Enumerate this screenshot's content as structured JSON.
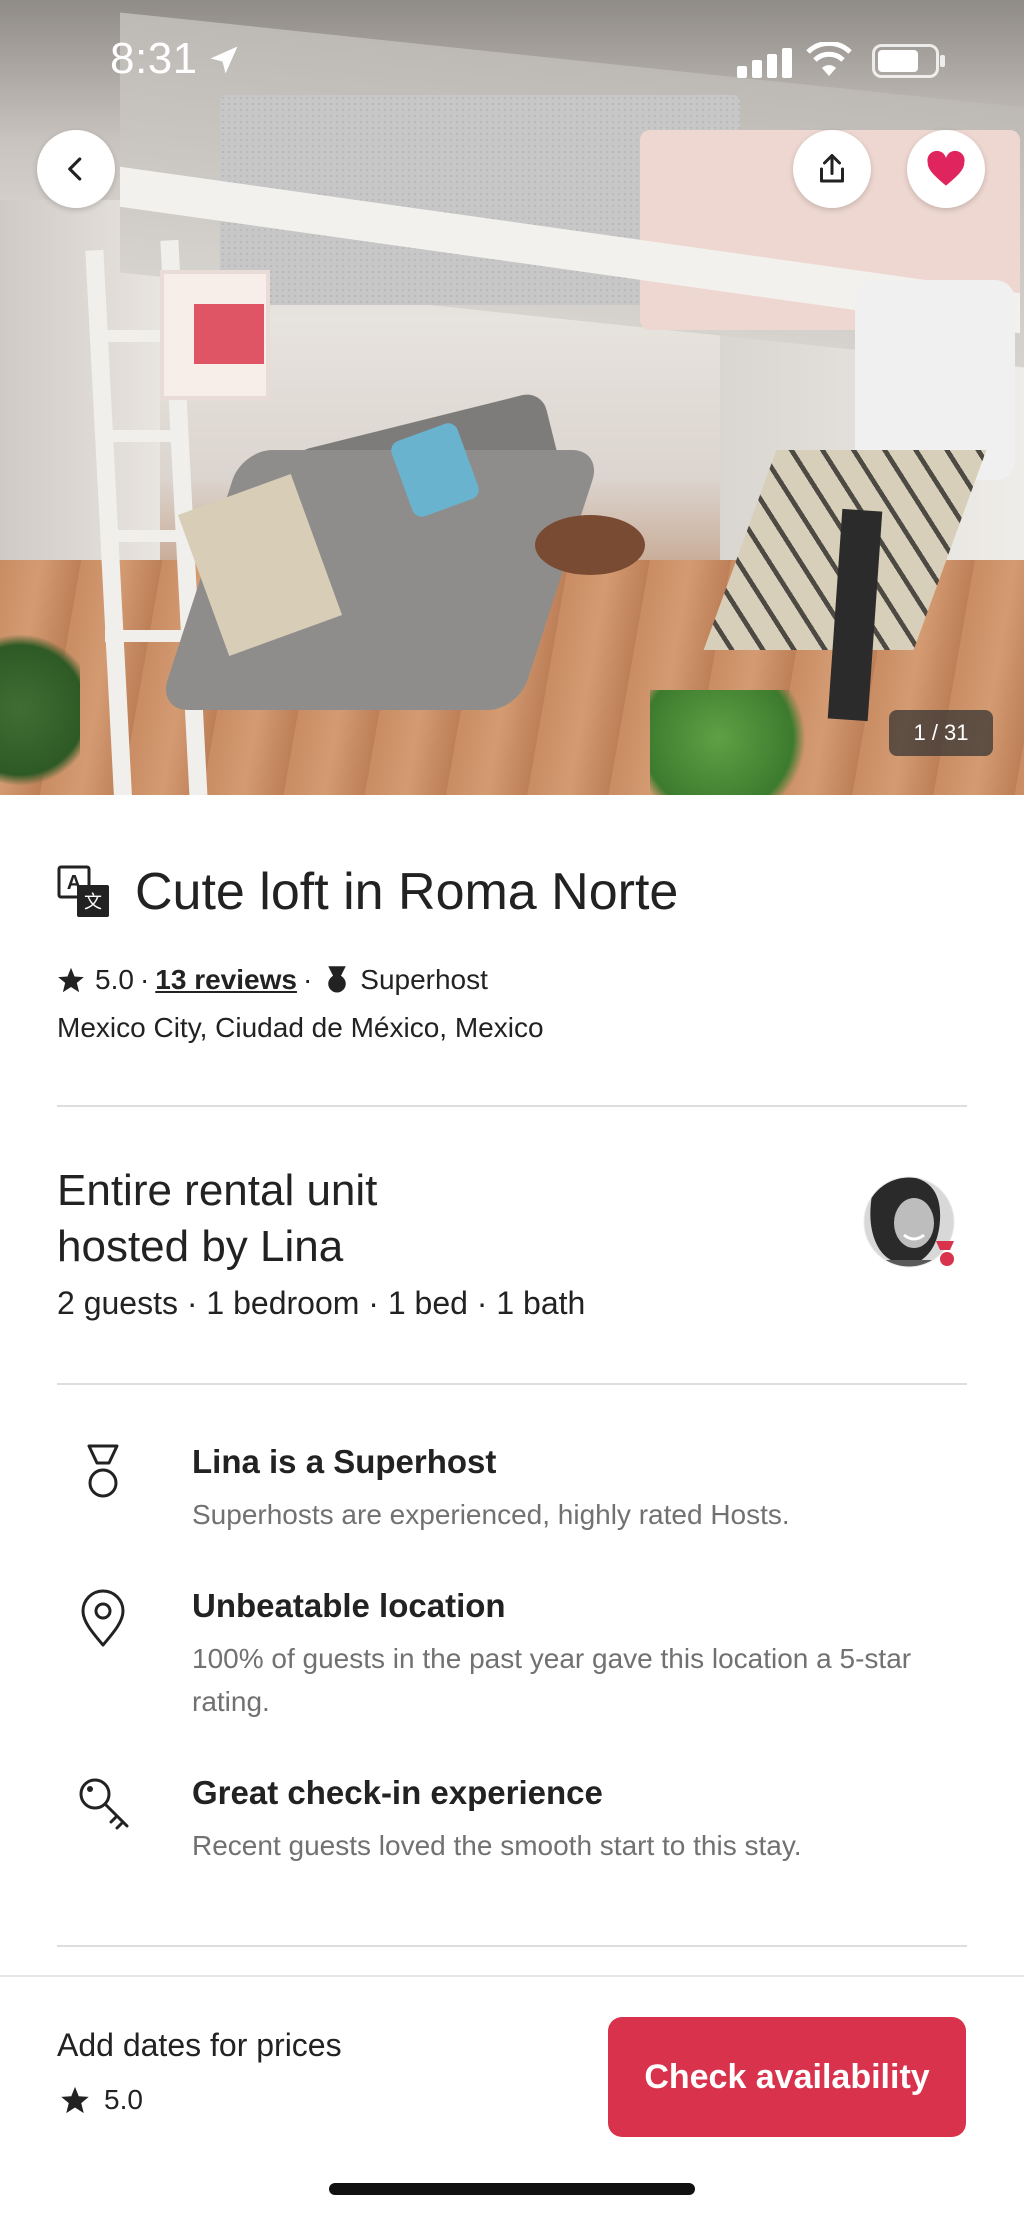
{
  "status_bar": {
    "time": "8:31"
  },
  "hero": {
    "photo_counter": "1 / 31"
  },
  "listing": {
    "title": "Cute loft in Roma Norte",
    "rating": "5.0",
    "separator": "·",
    "reviews_link": "13 reviews",
    "host_badge": "Superhost",
    "location": "Mexico City, Ciudad de México, Mexico"
  },
  "host_section": {
    "title_line1": "Entire rental unit",
    "title_line2": "hosted by Lina",
    "details": "2 guests · 1 bedroom · 1 bed · 1 bath"
  },
  "features": [
    {
      "icon": "superhost-medal-icon",
      "title": "Lina is a Superhost",
      "description": "Superhosts are experienced, highly rated Hosts."
    },
    {
      "icon": "location-pin-icon",
      "title": "Unbeatable location",
      "description": "100% of guests in the past year gave this location a 5-star rating."
    },
    {
      "icon": "key-icon",
      "title": "Great check-in experience",
      "description": "Recent guests loved the smooth start to this stay."
    }
  ],
  "bottom_bar": {
    "prices_label": "Add dates for prices",
    "rating": "5.0",
    "cta_label": "Check availability"
  },
  "colors": {
    "brand": "#d9324c",
    "text": "#222222",
    "muted": "#717171",
    "divider": "#dddddd"
  }
}
